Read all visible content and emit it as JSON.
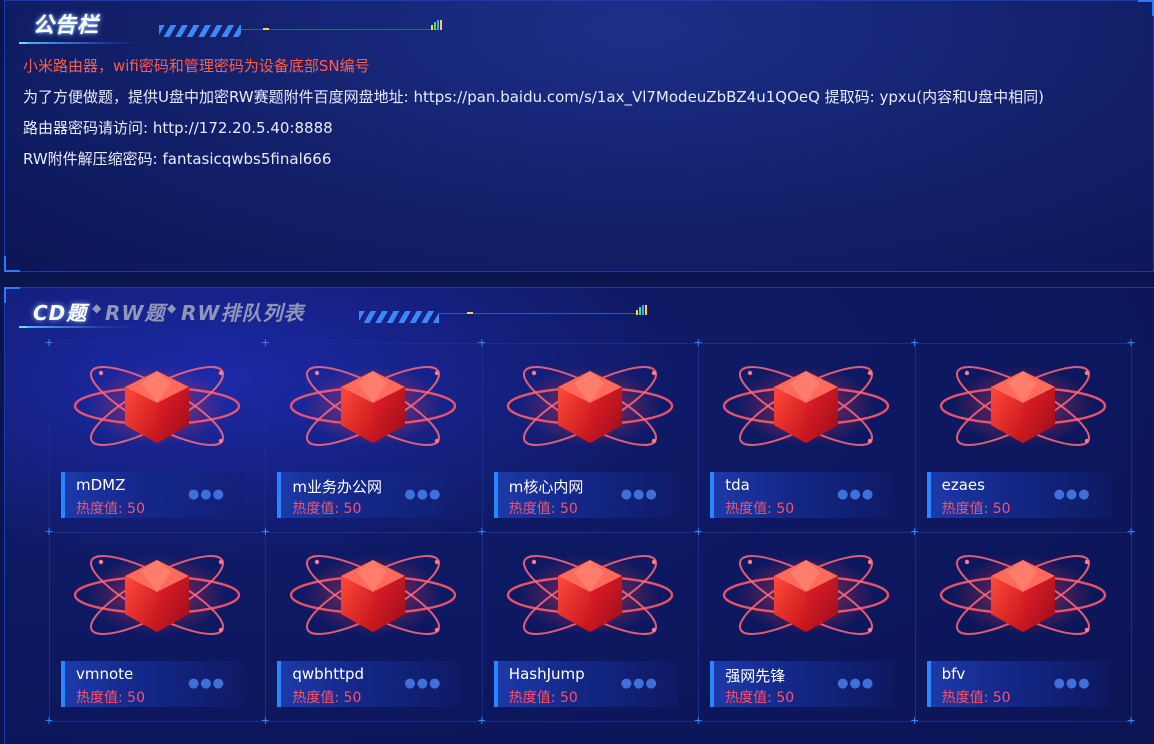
{
  "notice": {
    "title": "公告栏",
    "lines": [
      "小米路由器，wifi密码和管理密码为设备底部SN编号",
      "为了方便做题，提供U盘中加密RW赛题附件百度网盘地址: https://pan.baidu.com/s/1ax_Vl7ModeuZbBZ4u1QOeQ 提取码: ypxu(内容和U盘中相同)",
      "路由器密码请访问: http://172.20.5.40:8888",
      "RW附件解压缩密码: fantasicqwbs5final666"
    ],
    "accent_color": "#ff5e4a"
  },
  "tabs": {
    "items": [
      "CD题",
      "RW题",
      "RW排队列表"
    ],
    "separator": "◆",
    "active_index": 0
  },
  "challenges": [
    {
      "name": "mDMZ",
      "heat": "热度值: 50"
    },
    {
      "name": "m业务办公网",
      "heat": "热度值: 50"
    },
    {
      "name": "m核心内网",
      "heat": "热度值: 50"
    },
    {
      "name": "tda",
      "heat": "热度值: 50"
    },
    {
      "name": "ezaes",
      "heat": "热度值: 50"
    },
    {
      "name": "vmnote",
      "heat": "热度值: 50"
    },
    {
      "name": "qwbhttpd",
      "heat": "热度值: 50"
    },
    {
      "name": "HashJump",
      "heat": "热度值: 50"
    },
    {
      "name": "强网先锋",
      "heat": "热度值: 50"
    },
    {
      "name": "bfv",
      "heat": "热度值: 50"
    }
  ],
  "icons": {
    "card": "red-cube-atom-icon",
    "more": "more-dots-icon"
  },
  "colors": {
    "heat": "#ff4f6a",
    "accent": "#2a86ff",
    "background": "#0a1550"
  }
}
